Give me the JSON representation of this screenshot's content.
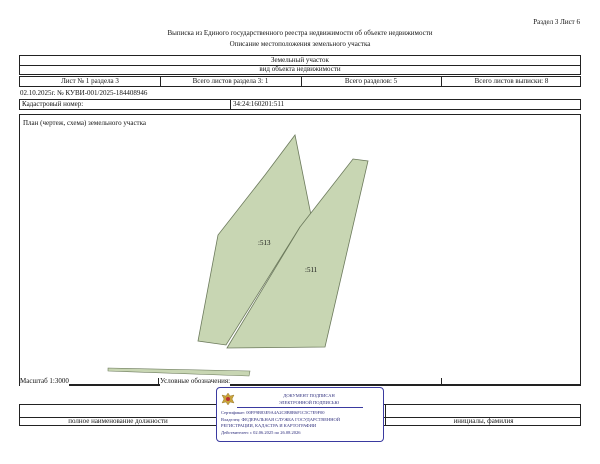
{
  "header": {
    "section_page": "Раздел 3   Лист 6",
    "title": "Выписка из Единого государственного реестра недвижимости об объекте недвижимости",
    "subtitle": "Описание местоположения земельного участка"
  },
  "object": {
    "type": "Земельный участок",
    "kind_label": "вид объекта недвижимости"
  },
  "sheet_info": {
    "sheet": "Лист № 1 раздела 3",
    "total_sheets_section": "Всего листов раздела 3: 1",
    "total_sections": "Всего разделов: 5",
    "total_sheets_extract": "Всего листов выписки: 8"
  },
  "document": {
    "number": "02.10.2025г. № КУВИ-001/2025-184408946",
    "cadastral_label": "Кадастровый номер:",
    "cadastral_value": "34:24:160201:511"
  },
  "plan": {
    "title": "План (чертеж, схема) земельного участка",
    "label_a": ":513",
    "label_b": ":511",
    "colors": {
      "parcel_a": "#c8d6b3",
      "parcel_b": "#c8d6b3",
      "outline": "#6c7a5c"
    }
  },
  "footer": {
    "scale": "Масштаб 1:3000",
    "legend": "Условные обозначения:",
    "position_caption": "полное наименование должности",
    "name_caption": "инициалы, фамилия"
  },
  "stamp": {
    "line1": "ДОКУМЕНТ ПОДПИСАН",
    "line2": "ЭЛЕКТРОННОЙ ПОДПИСЬЮ",
    "line3": "Сертификат: 00FF9B83E9A4A2C8B8B6F1C5C7E9F00",
    "line4": "Владелец: ФЕДЕРАЛЬНАЯ СЛУЖБА ГОСУДАРСТВЕННОЙ",
    "line5": "РЕГИСТРАЦИИ, КАДАСТРА И КАРТОГРАФИИ",
    "line6": "Действителен: с 02.06.2025 по 26.08.2026",
    "emblem": "eagle-emblem-icon"
  }
}
